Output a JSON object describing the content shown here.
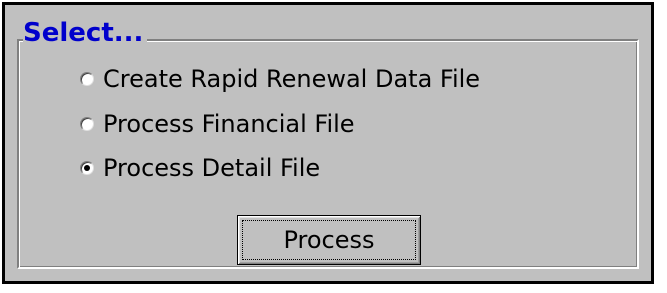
{
  "group": {
    "title": "Select..."
  },
  "options": [
    {
      "label": "Create Rapid Renewal Data File",
      "checked": false
    },
    {
      "label": "Process Financial File",
      "checked": false
    },
    {
      "label": "Process Detail File",
      "checked": true
    }
  ],
  "process_button": {
    "label": "Process"
  },
  "colors": {
    "title": "#0000cc",
    "background": "#c0c0c0",
    "border": "#000000"
  }
}
